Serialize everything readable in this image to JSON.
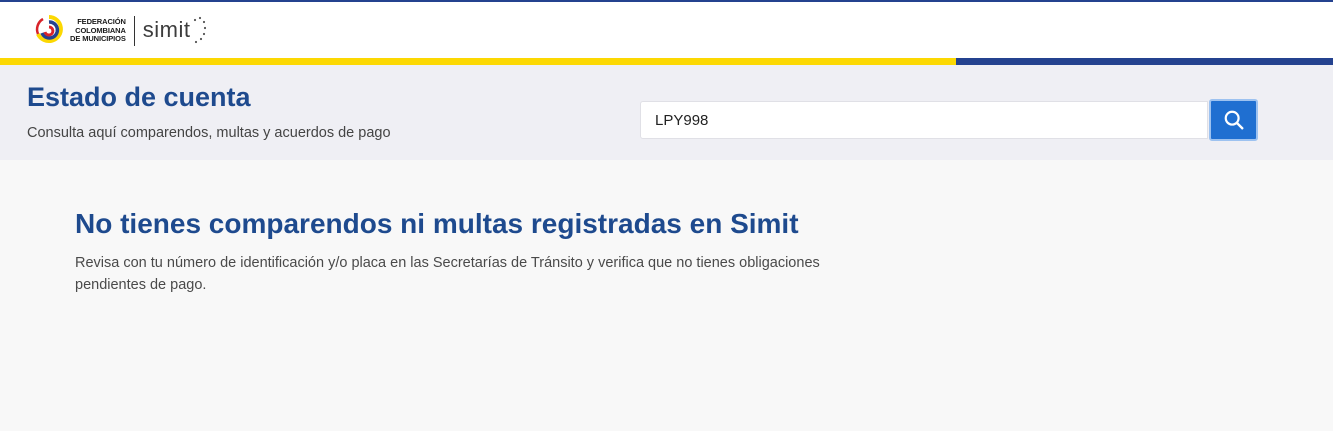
{
  "header": {
    "federation_lines": [
      "FEDERACIÓN",
      "COLOMBIANA",
      "DE MUNICIPIOS"
    ],
    "simit_word": "simit"
  },
  "banner": {
    "title": "Estado de cuenta",
    "subtitle": "Consulta aquí comparendos, multas y acuerdos de pago"
  },
  "search": {
    "value": "LPY998",
    "button_icon": "search-icon"
  },
  "result": {
    "title": "No tienes comparendos ni multas registradas en Simit",
    "description": "Revisa con tu número de identificación y/o placa en las Secretarías de Tránsito y verifica que no tienes obligaciones pendientes de pago."
  },
  "colors": {
    "brand_blue": "#1e4a8e",
    "stripe_yellow": "#fcd802",
    "stripe_blue": "#24428f",
    "button_blue": "#1f6fd1"
  }
}
